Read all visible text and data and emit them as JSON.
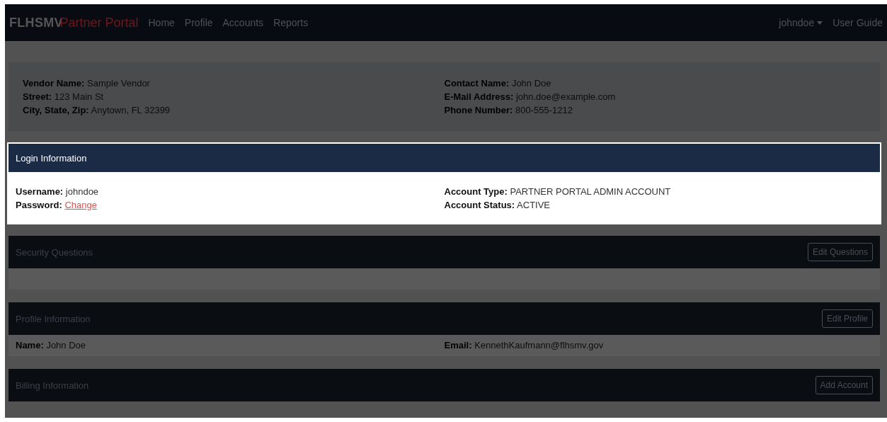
{
  "navbar": {
    "brand": "FLHSMV",
    "brand_suffix": "Partner Portal",
    "links": [
      "Home",
      "Profile",
      "Accounts",
      "Reports"
    ],
    "user_menu": "johndoe",
    "help_link": "User Guide"
  },
  "vendor": {
    "columns": [
      [
        {
          "label": "Vendor Name:",
          "value": "Sample Vendor"
        },
        {
          "label": "Street:",
          "value": "123 Main St"
        },
        {
          "label": "City, State, Zip:",
          "value": "Anytown, FL 32399"
        }
      ],
      [
        {
          "label": "Contact Name:",
          "value": "John Doe"
        },
        {
          "label": "E-Mail Address:",
          "value": "john.doe@example.com"
        },
        {
          "label": "Phone Number:",
          "value": "800-555-1212"
        }
      ]
    ]
  },
  "sections": [
    {
      "title": "Login Information",
      "highlighted": true,
      "kind": "details",
      "columns": [
        [
          {
            "label": "Username:",
            "value": "johndoe",
            "kind": "text"
          },
          {
            "label": "Password:",
            "value": "Change",
            "kind": "link"
          }
        ],
        [
          {
            "label": "Account Type:",
            "value": "PARTNER PORTAL ADMIN ACCOUNT",
            "kind": "text"
          },
          {
            "label": "Account Status:",
            "value": "ACTIVE",
            "kind": "text"
          }
        ]
      ]
    },
    {
      "title": "Security Questions",
      "highlighted": false,
      "kind": "empty",
      "button": "Edit Questions"
    },
    {
      "title": "Profile Information",
      "highlighted": false,
      "kind": "details",
      "button": "Edit Profile",
      "columns": [
        [
          {
            "label": "Name:",
            "value": "John Doe",
            "kind": "text"
          }
        ],
        [
          {
            "label": "Email:",
            "value": "KennethKaufmann@flhsmv.gov",
            "kind": "text"
          }
        ]
      ]
    },
    {
      "title": "Billing Information",
      "highlighted": false,
      "kind": "header",
      "button": "Add Account"
    }
  ]
}
